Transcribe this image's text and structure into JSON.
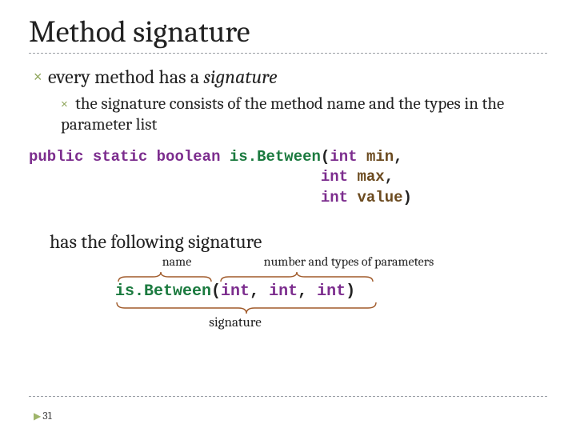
{
  "title": "Method signature",
  "bullet1": {
    "marker": "×",
    "pre": "every method has a ",
    "em": "signature"
  },
  "bullet2": {
    "marker": "×",
    "text": "the signature consists of the method name and the types in the parameter list"
  },
  "code": {
    "l1": {
      "kw1": "public",
      "kw2": "static",
      "kw3": "boolean",
      "mth": "is.Between",
      "typ": "int",
      "par": "min",
      "trail": ","
    },
    "l2": {
      "indent": "                                ",
      "typ": "int",
      "par": "max",
      "trail": ","
    },
    "l3": {
      "indent": "                                ",
      "typ": "int",
      "par": "value",
      "trail": ")"
    }
  },
  "subhead": "has the following signature",
  "ann": {
    "name": "name",
    "params": "number and types of parameters"
  },
  "sig": {
    "mth": "is.Between",
    "open": "(",
    "t1": "int",
    "c1": ", ",
    "t2": "int",
    "c2": ", ",
    "t3": "int",
    "close": ")"
  },
  "sig_under": "signature",
  "page": "31"
}
